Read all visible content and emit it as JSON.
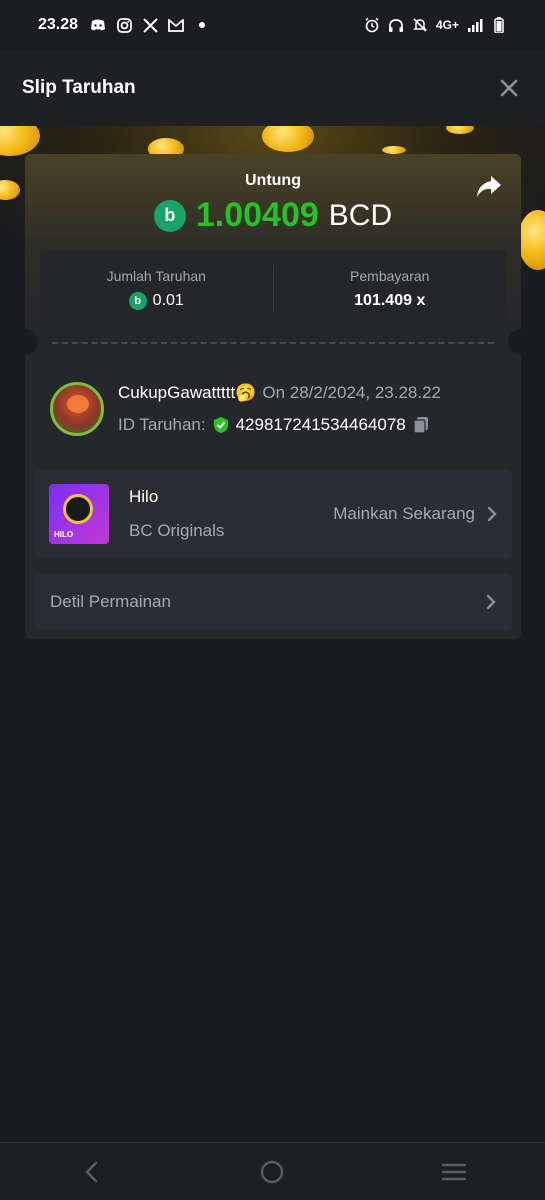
{
  "status_bar": {
    "time": "23.28",
    "network": "4G+"
  },
  "header": {
    "title": "Slip Taruhan"
  },
  "profit": {
    "label": "Untung",
    "amount": "1.00409",
    "currency": "BCD",
    "amount_color": "#25c323"
  },
  "stats": {
    "bet_amount_label": "Jumlah Taruhan",
    "bet_amount_value": "0.01",
    "payout_label": "Pembayaran",
    "payout_value": "101.409 x"
  },
  "user": {
    "name": "CukupGawattttt🥱",
    "date": "On 28/2/2024, 23.28.22",
    "bet_id_label": "ID Taruhan:",
    "bet_id": "429817241534464078"
  },
  "game": {
    "name": "Hilo",
    "provider": "BC Originals",
    "play_label": "Mainkan Sekarang",
    "thumb_tag": "HILO"
  },
  "details": {
    "label": "Detil Permainan"
  },
  "colors": {
    "background": "#1b1c1f",
    "card": "#26272b",
    "accent_green": "#25c323",
    "bc_logo": "#1aa366"
  }
}
